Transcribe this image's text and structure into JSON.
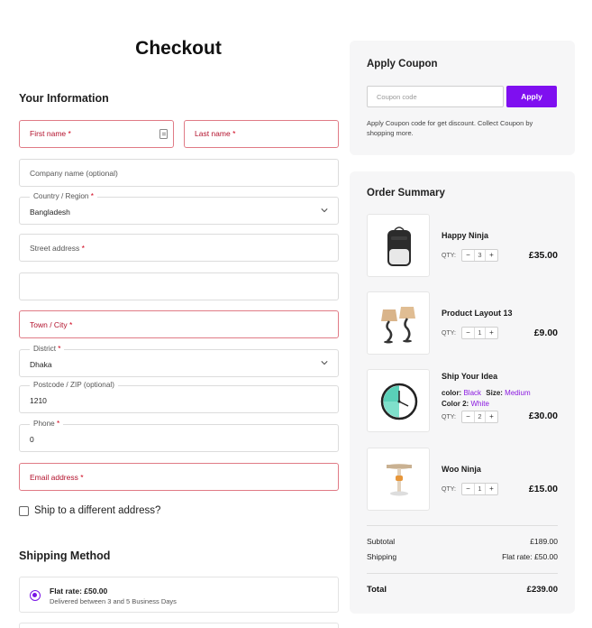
{
  "page": {
    "title": "Checkout"
  },
  "your_info": {
    "heading": "Your Information",
    "first_name": {
      "placeholder": "First name",
      "req": "*"
    },
    "last_name": {
      "placeholder": "Last name",
      "req": "*"
    },
    "company": {
      "placeholder": "Company name (optional)"
    },
    "country": {
      "label": "Country / Region",
      "req": "*",
      "value": "Bangladesh"
    },
    "street": {
      "placeholder": "Street address",
      "req": "*"
    },
    "street2": {
      "value": ""
    },
    "town": {
      "placeholder": "Town / City",
      "req": "*"
    },
    "district": {
      "label": "District",
      "req": "*",
      "value": "Dhaka"
    },
    "postcode": {
      "label": "Postcode / ZIP (optional)",
      "value": "1210"
    },
    "phone": {
      "label": "Phone",
      "req": "*",
      "value": "0"
    },
    "email": {
      "placeholder": "Email address",
      "req": "*"
    },
    "ship_different": "Ship to a different address?"
  },
  "shipping": {
    "heading": "Shipping Method",
    "option_name": "Flat rate: £50.00",
    "option_desc": "Delivered between 3 and 5 Business Days",
    "selected": true
  },
  "coupon": {
    "heading": "Apply Coupon",
    "placeholder": "Coupon code",
    "button": "Apply",
    "help": "Apply Coupon code for get discount. Collect Coupon by shopping more."
  },
  "summary": {
    "heading": "Order Summary",
    "qty_label": "QTY:",
    "items": [
      {
        "name": "Happy Ninja",
        "qty": "3",
        "price": "£35.00",
        "icon": "backpack-icon"
      },
      {
        "name": "Product Layout 13",
        "qty": "1",
        "price": "£9.00",
        "icon": "lamps-icon"
      },
      {
        "name": "Ship Your Idea",
        "qty": "2",
        "price": "£30.00",
        "icon": "clock-icon",
        "color_label": "color:",
        "color_value": "Black",
        "size_label": "Size:",
        "size_value": "Medium",
        "color2_label": "Color 2:",
        "color2_value": "White"
      },
      {
        "name": "Woo Ninja",
        "qty": "1",
        "price": "£15.00",
        "icon": "side-table-icon"
      }
    ],
    "subtotal_label": "Subtotal",
    "subtotal_value": "£189.00",
    "shipping_label": "Shipping",
    "shipping_value": "Flat rate: £50.00",
    "total_label": "Total",
    "total_value": "£239.00"
  },
  "colors": {
    "accent": "#7f0ff0",
    "error_border": "#e07b86",
    "required": "#d0021b",
    "panel_bg": "#f6f6f7"
  }
}
